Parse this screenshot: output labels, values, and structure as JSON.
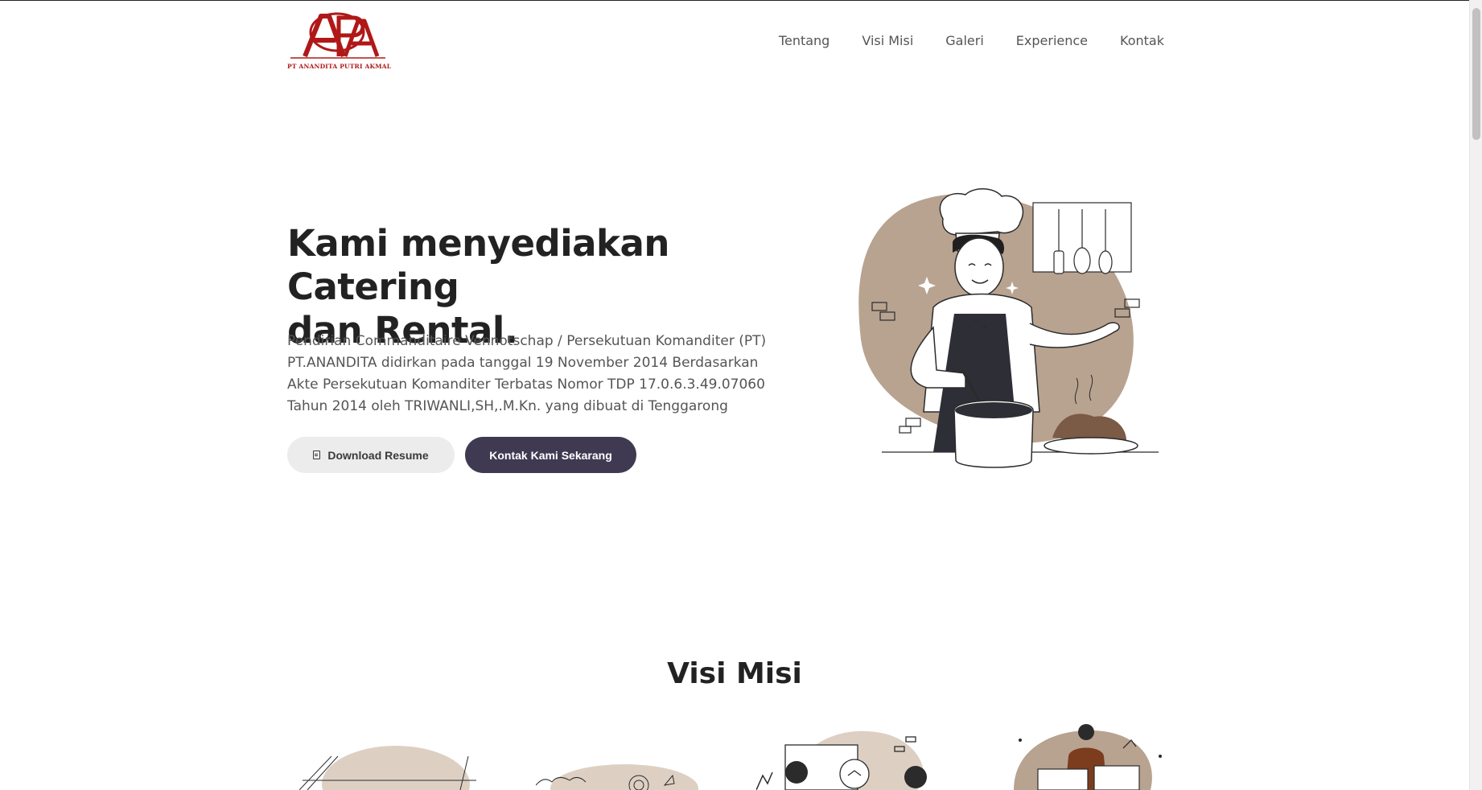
{
  "colors": {
    "brand_red": "#b01818",
    "accent_tan": "#b8a390",
    "dark_button": "#3f3a51",
    "light_button": "#ececec"
  },
  "header": {
    "logo_letters": "APA",
    "logo_company": "PT ANANDITA PUTRI AKMAL",
    "nav": [
      "Tentang",
      "Visi Misi",
      "Galeri",
      "Experience",
      "Kontak"
    ]
  },
  "hero": {
    "title_line1": "Kami menyediakan Catering",
    "title_line2": "dan Rental.",
    "description": "Pendirian Commanditaire Vennotschap / Persekutuan Komanditer (PT) PT.ANANDITA didirkan pada tanggal 19 November 2014 Berdasarkan Akte Persekutuan Komanditer Terbatas Nomor TDP 17.0.6.3.49.07060 Tahun 2014 oleh TRIWANLI,SH,.M.Kn. yang dibuat di Tenggarong",
    "download_label": "Download Resume",
    "download_icon": "document-icon",
    "contact_label": "Kontak Kami Sekarang",
    "illustration": "chef-cooking-illustration"
  },
  "visi_misi": {
    "title": "Visi Misi",
    "illustrations": [
      "planning-illustration",
      "target-illustration",
      "meeting-illustration",
      "presentation-illustration"
    ]
  }
}
